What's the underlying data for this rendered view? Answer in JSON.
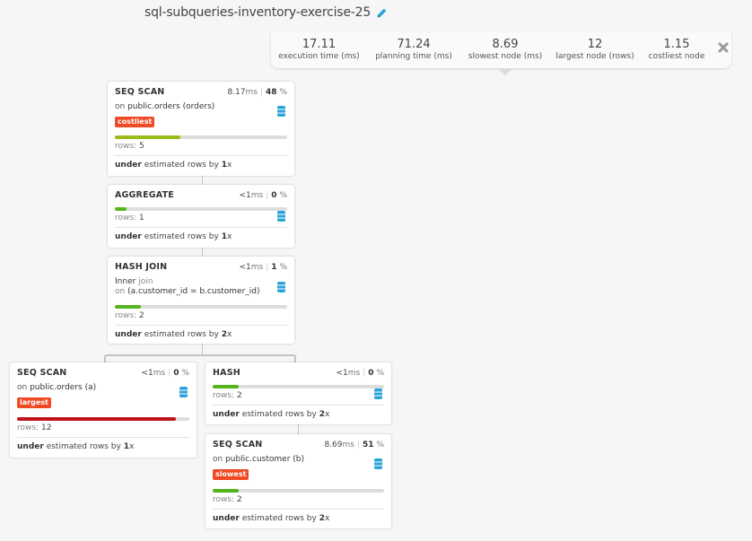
{
  "title": "sql-subqueries-inventory-exercise-25",
  "icons": {
    "edit": "pencil-icon",
    "close": "close-icon",
    "database": "database-icon"
  },
  "colors": {
    "badge": "#ef4a24",
    "bar_green": "#53b61c",
    "bar_olive": "#9bbb1a",
    "bar_red": "#c0141a",
    "db_icon": "#2aa3d9"
  },
  "stats": [
    {
      "value": "17.11",
      "label": "execution time (ms)"
    },
    {
      "value": "71.24",
      "label": "planning time (ms)"
    },
    {
      "value": "8.69",
      "label": "slowest node (ms)"
    },
    {
      "value": "12",
      "label": "largest node (rows)"
    },
    {
      "value": "1.15",
      "label": "costliest node"
    }
  ],
  "nodes": [
    {
      "type": "SEQ SCAN",
      "time": "8.17",
      "time_unit": "ms",
      "percent": "48",
      "pct_sign": "%",
      "desc_prefix": "on",
      "desc": "public.orders (orders)",
      "badge": "costliest",
      "rows_label": "rows:",
      "rows": "5",
      "bar_fraction": 0.38,
      "foot_strong": "under",
      "foot_text": "estimated rows by",
      "factor": "1",
      "factor_unit": "x"
    },
    {
      "type": "AGGREGATE",
      "time": "<1",
      "time_unit": "ms",
      "percent": "0",
      "pct_sign": "%",
      "rows_label": "rows:",
      "rows": "1",
      "bar_fraction": 0.07,
      "foot_strong": "under",
      "foot_text": "estimated rows by",
      "factor": "1",
      "factor_unit": "x"
    },
    {
      "type": "HASH JOIN",
      "time": "<1",
      "time_unit": "ms",
      "percent": "1",
      "pct_sign": "%",
      "join_type": "Inner",
      "join_word": "join",
      "desc_prefix": "on",
      "desc": "(a.customer_id = b.customer_id)",
      "rows_label": "rows:",
      "rows": "2",
      "bar_fraction": 0.15,
      "foot_strong": "under",
      "foot_text": "estimated rows by",
      "factor": "2",
      "factor_unit": "x"
    },
    {
      "type": "SEQ SCAN",
      "time": "<1",
      "time_unit": "ms",
      "percent": "0",
      "pct_sign": "%",
      "desc_prefix": "on",
      "desc": "public.orders (a)",
      "badge": "largest",
      "rows_label": "rows:",
      "rows": "12",
      "bar_fraction": 0.92,
      "foot_strong": "under",
      "foot_text": "estimated rows by",
      "factor": "1",
      "factor_unit": "x"
    },
    {
      "type": "HASH",
      "time": "<1",
      "time_unit": "ms",
      "percent": "0",
      "pct_sign": "%",
      "rows_label": "rows:",
      "rows": "2",
      "bar_fraction": 0.15,
      "foot_strong": "under",
      "foot_text": "estimated rows by",
      "factor": "2",
      "factor_unit": "x"
    },
    {
      "type": "SEQ SCAN",
      "time": "8.69",
      "time_unit": "ms",
      "percent": "51",
      "pct_sign": "%",
      "desc_prefix": "on",
      "desc": "public.customer (b)",
      "badge": "slowest",
      "rows_label": "rows:",
      "rows": "2",
      "bar_fraction": 0.15,
      "foot_strong": "under",
      "foot_text": "estimated rows by",
      "factor": "2",
      "factor_unit": "x"
    }
  ]
}
